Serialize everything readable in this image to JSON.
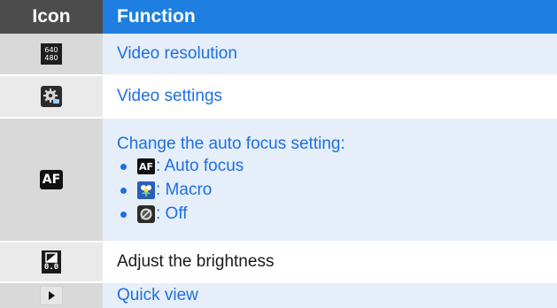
{
  "header": {
    "icon_label": "Icon",
    "function_label": "Function"
  },
  "rows": [
    {
      "icon": "video-resolution-icon",
      "icon_text": [
        "640",
        "480"
      ],
      "function": "Video resolution"
    },
    {
      "icon": "video-settings-gear-icon",
      "function": "Video settings"
    },
    {
      "icon": "auto-focus-icon",
      "icon_text": "AF",
      "function": "Change the auto focus setting:",
      "options": [
        {
          "icon": "auto-focus-icon",
          "icon_text": "AF",
          "label": ": Auto focus"
        },
        {
          "icon": "macro-flower-icon",
          "label": ": Macro"
        },
        {
          "icon": "focus-off-icon",
          "label": ": Off"
        }
      ]
    },
    {
      "icon": "brightness-icon",
      "icon_text": "0.0",
      "function": "Adjust the brightness"
    },
    {
      "icon": "play-triangle-icon",
      "function": "Quick view"
    }
  ],
  "colors": {
    "header_icon_bg": "#4c4c4c",
    "header_function_bg": "#1f7fe0",
    "link_text": "#1f6fe0",
    "plain_text": "#1a1a1a"
  }
}
